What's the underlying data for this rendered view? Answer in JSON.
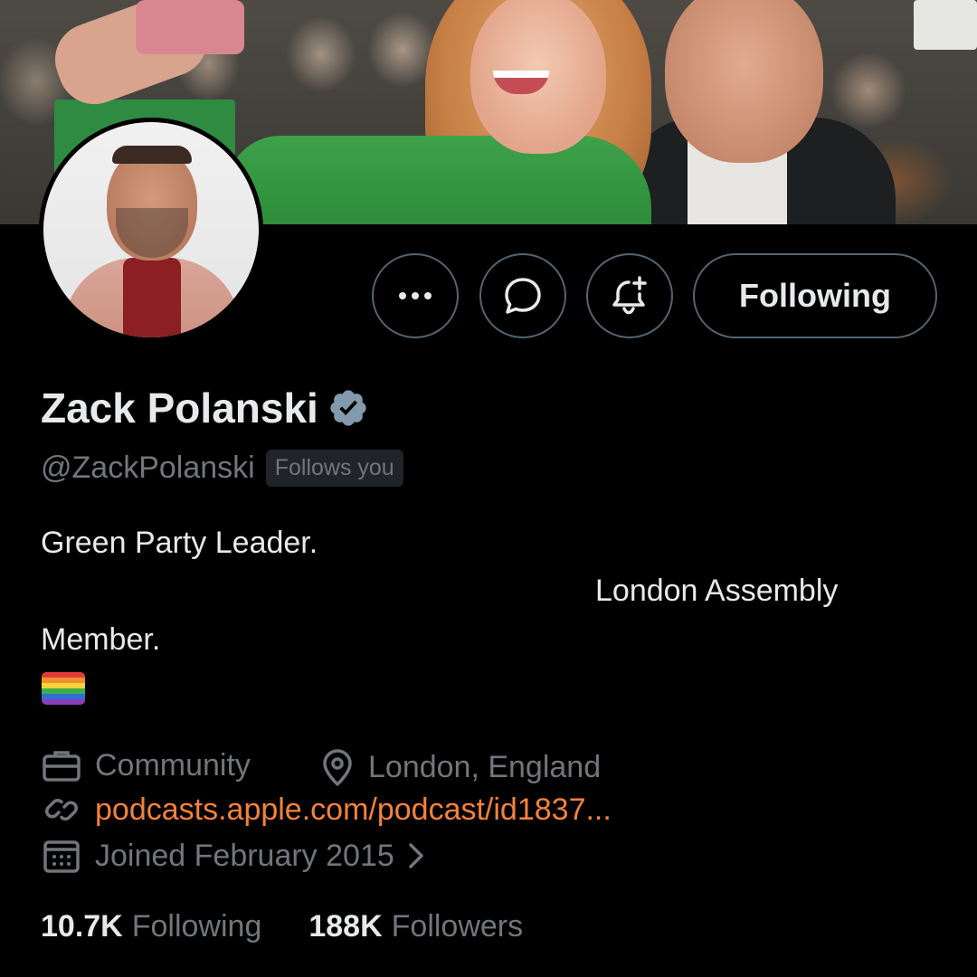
{
  "profile": {
    "name": "Zack Polanski",
    "handle": "@ZackPolanski",
    "follows_you_badge": "Follows you",
    "bio": {
      "line1": "Green Party Leader.",
      "line2": "London Assembly",
      "line3": "Member."
    },
    "category": "Community",
    "location": "London, England",
    "website": "podcasts.apple.com/podcast/id1837...",
    "joined": "Joined February 2015",
    "following_count": "10.7K",
    "following_label": "Following",
    "followers_count": "188K",
    "followers_label": "Followers"
  },
  "actions": {
    "more_icon": "more-horizontal-icon",
    "message_icon": "message-icon",
    "notify_icon": "bell-plus-icon",
    "follow_button_label": "Following"
  },
  "colors": {
    "background": "#000000",
    "link": "#f4823a",
    "muted": "#71767b",
    "border": "#536471",
    "verified": "#829aab"
  }
}
